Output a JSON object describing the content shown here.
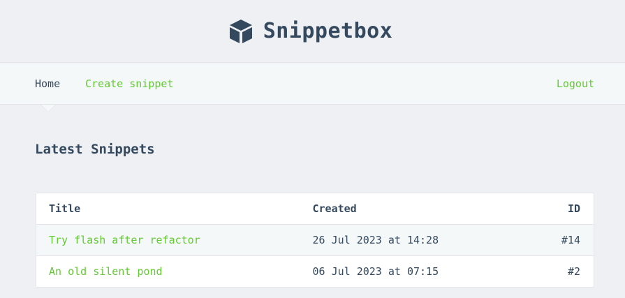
{
  "header": {
    "brand_title": "Snippetbox",
    "logo_icon": "cube-icon"
  },
  "nav": {
    "home_label": "Home",
    "create_label": "Create snippet",
    "logout_label": "Logout",
    "active": "Home"
  },
  "main": {
    "page_title": "Latest Snippets",
    "table": {
      "headers": {
        "title": "Title",
        "created": "Created",
        "id": "ID"
      },
      "rows": [
        {
          "title": "Try flash after refactor",
          "created": "26 Jul 2023 at 14:28",
          "id": "#14"
        },
        {
          "title": "An old silent pond",
          "created": "06 Jul 2023 at 07:15",
          "id": "#2"
        }
      ]
    }
  },
  "colors": {
    "background": "#eff0f4",
    "nav_background": "#f5f8f9",
    "text": "#34495e",
    "accent_green": "#62cb31",
    "border": "#e4e5e7"
  }
}
